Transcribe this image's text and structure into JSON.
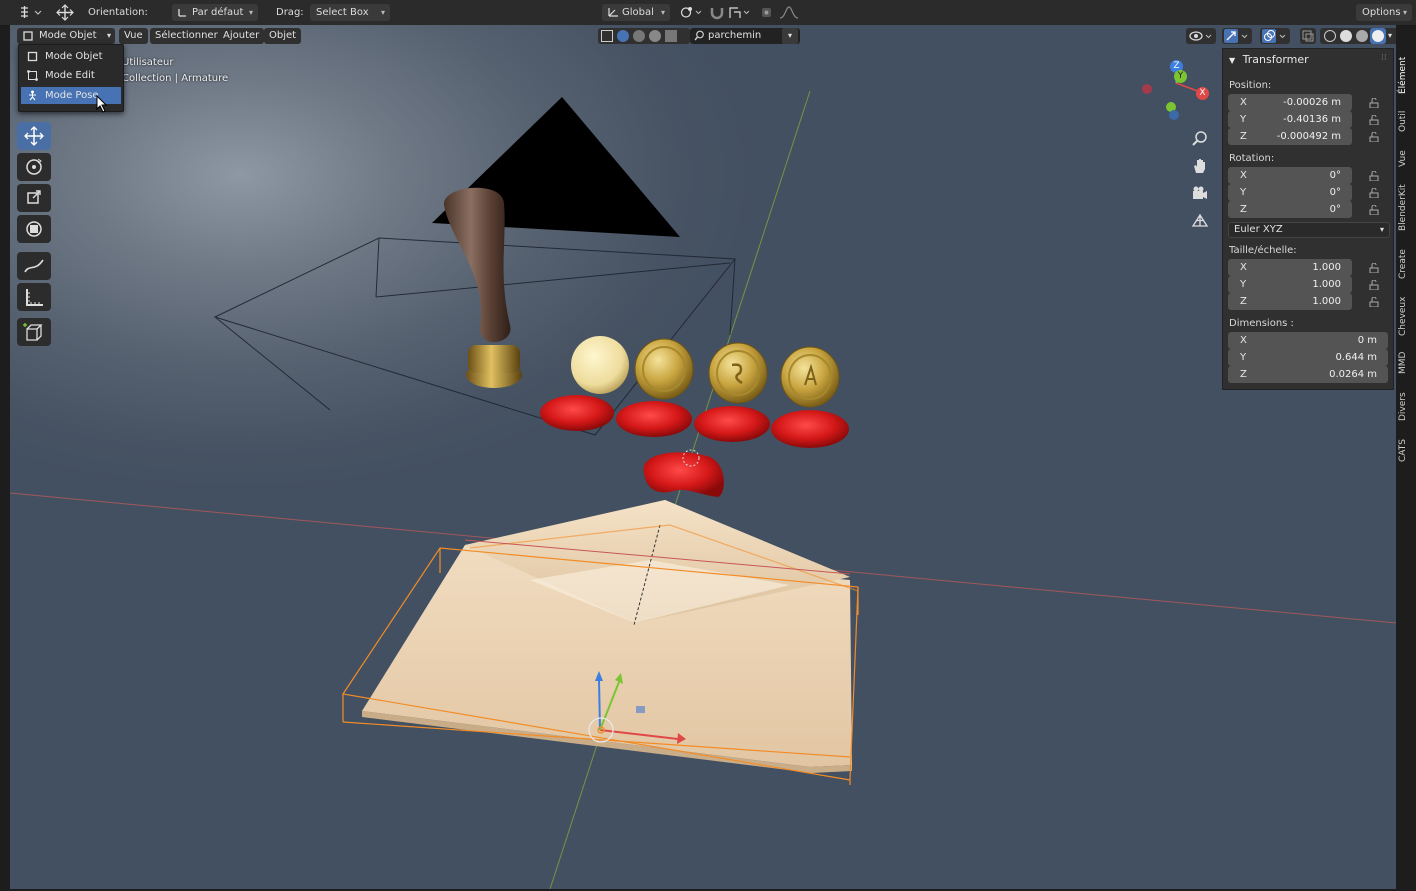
{
  "topbar": {
    "orientation_label": "Orientation:",
    "orientation_value": "Par défaut",
    "drag_label": "Drag:",
    "drag_value": "Select Box",
    "transform_space": "Global",
    "options_label": "Options"
  },
  "header": {
    "mode_button": "Mode Objet",
    "menus": [
      "Vue",
      "Sélectionner",
      "Ajouter",
      "Objet"
    ],
    "search_value": "parchemin"
  },
  "mode_menu": {
    "items": [
      {
        "label": "Mode Objet",
        "icon": "object-mode-icon"
      },
      {
        "label": "Mode Edit",
        "icon": "edit-mode-icon"
      },
      {
        "label": "Mode Pose",
        "icon": "pose-mode-icon"
      }
    ],
    "highlighted": "Mode Pose"
  },
  "overlay": {
    "line1": "Utilisateur",
    "line2": "Collection | Armature"
  },
  "npanel": {
    "title": "Transformer",
    "position_label": "Position:",
    "position": [
      {
        "axis": "X",
        "value": "-0.00026 m"
      },
      {
        "axis": "Y",
        "value": "-0.40136 m"
      },
      {
        "axis": "Z",
        "value": "-0.000492 m"
      }
    ],
    "rotation_label": "Rotation:",
    "rotation": [
      {
        "axis": "X",
        "value": "0°"
      },
      {
        "axis": "Y",
        "value": "0°"
      },
      {
        "axis": "Z",
        "value": "0°"
      }
    ],
    "rotation_mode": "Euler XYZ",
    "scale_label": "Taille/échelle:",
    "scale": [
      {
        "axis": "X",
        "value": "1.000"
      },
      {
        "axis": "Y",
        "value": "1.000"
      },
      {
        "axis": "Z",
        "value": "1.000"
      }
    ],
    "dimensions_label": "Dimensions :",
    "dimensions": [
      {
        "axis": "X",
        "value": "0 m"
      },
      {
        "axis": "Y",
        "value": "0.644 m"
      },
      {
        "axis": "Z",
        "value": "0.0264 m"
      }
    ]
  },
  "side_tabs": [
    "Élément",
    "Outil",
    "Vue",
    "BlenderKit",
    "Create",
    "Cheveux",
    "MMD",
    "Divers",
    "CATS"
  ],
  "gizmo": {
    "x": "X",
    "y": "Y",
    "z": "Z"
  },
  "colors": {
    "accent": "#4772b3",
    "axis_x": "#e04848",
    "axis_y": "#7cc532",
    "axis_z": "#3d7fe0",
    "selection": "#f28c28",
    "wax": "#d91f1f"
  }
}
